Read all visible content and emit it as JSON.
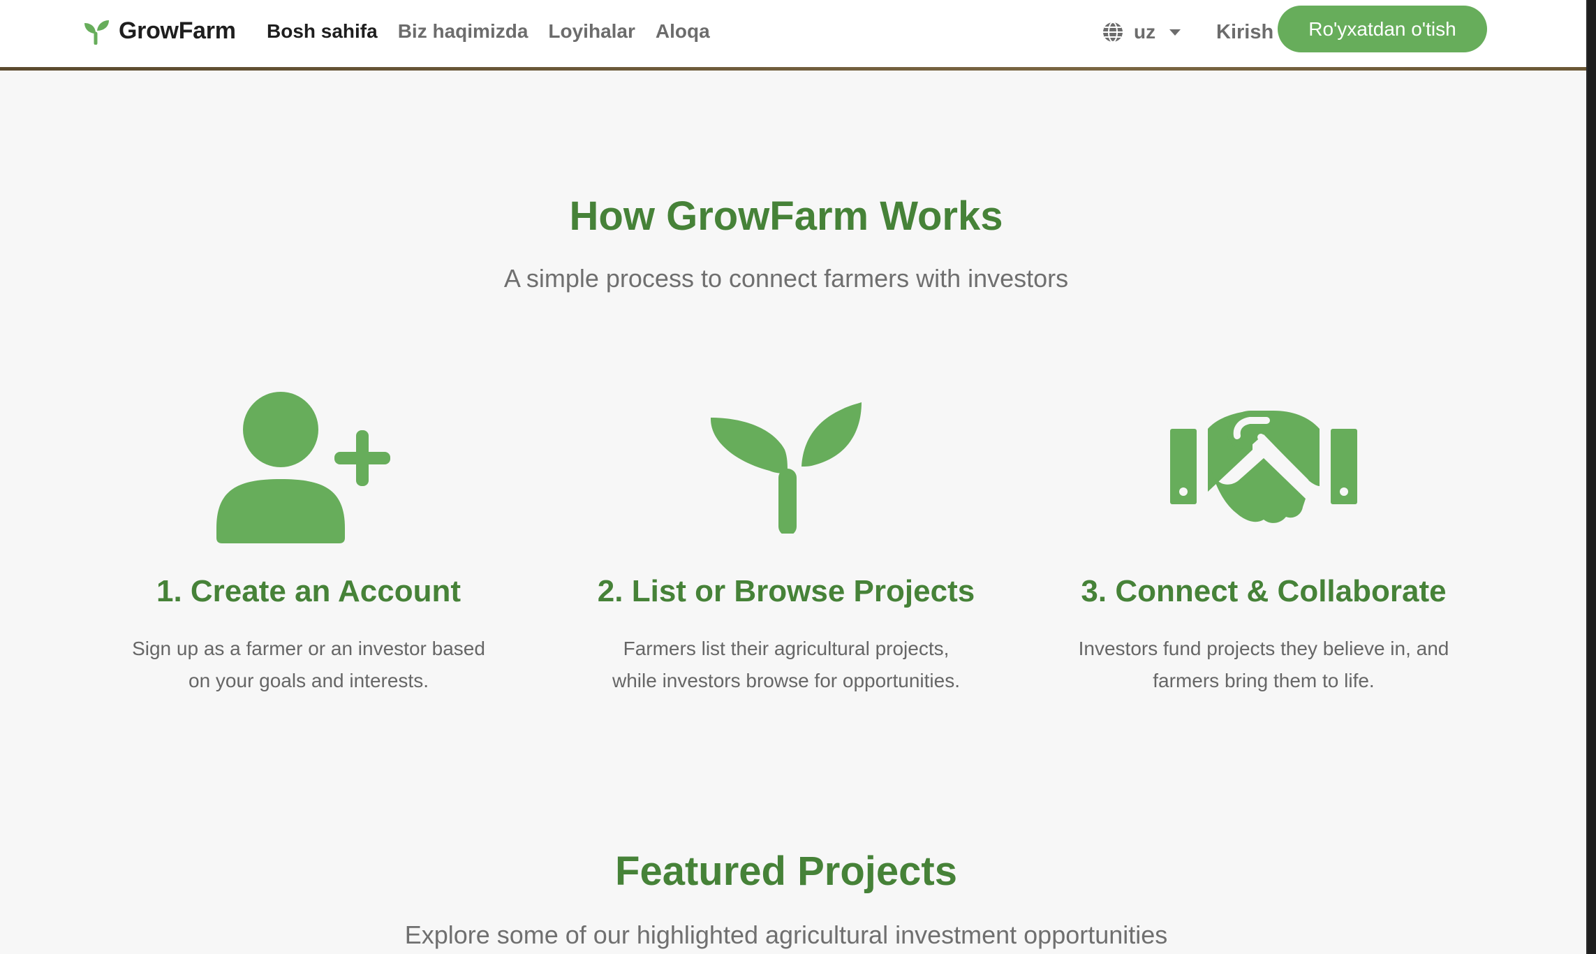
{
  "navbar": {
    "brand": "GrowFarm",
    "links": [
      {
        "label": "Bosh sahifa",
        "active": true
      },
      {
        "label": "Biz haqimizda",
        "active": false
      },
      {
        "label": "Loyihalar",
        "active": false
      },
      {
        "label": "Aloqa",
        "active": false
      }
    ],
    "language": "uz",
    "login_label": "Kirish",
    "signup_label": "Ro'yxatdan o'tish"
  },
  "how_it_works": {
    "title": "How GrowFarm Works",
    "subtitle": "A simple process to connect farmers with investors",
    "steps": [
      {
        "icon": "add-user-icon",
        "title": "1. Create an Account",
        "desc_line1": "Sign up as a farmer or an investor based",
        "desc_line2": "on your goals and interests."
      },
      {
        "icon": "seedling-icon",
        "title": "2. List or Browse Projects",
        "desc_line1": "Farmers list their agricultural projects,",
        "desc_line2": "while investors browse for opportunities."
      },
      {
        "icon": "handshake-icon",
        "title": "3. Connect & Collaborate",
        "desc_line1": "Investors fund projects they believe in, and",
        "desc_line2": "farmers bring them to life."
      }
    ]
  },
  "featured": {
    "title": "Featured Projects",
    "subtitle": "Explore some of our highlighted agricultural investment opportunities"
  },
  "colors": {
    "accent": "#67ad5b",
    "heading_green": "#468238",
    "text_gray": "#6f6f6f"
  }
}
